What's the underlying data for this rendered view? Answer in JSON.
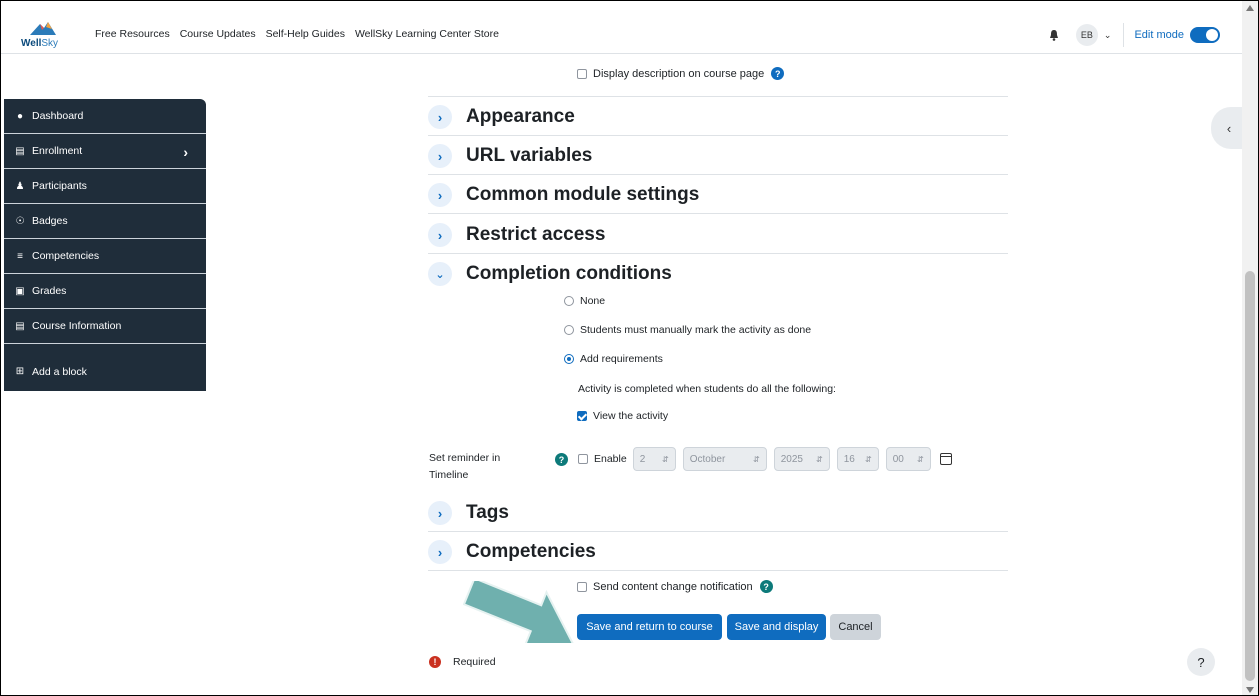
{
  "brand": {
    "name_a": "Well",
    "name_b": "Sky"
  },
  "nav": {
    "items": [
      "Free Resources",
      "Course Updates",
      "Self-Help Guides",
      "WellSky Learning Center Store"
    ]
  },
  "user": {
    "initials": "EB",
    "edit_mode_label": "Edit mode",
    "edit_mode_on": true
  },
  "sidebar": {
    "items": [
      {
        "label": "Dashboard",
        "icon": "dashboard-icon"
      },
      {
        "label": "Enrollment",
        "icon": "bank-icon",
        "has_submenu": true
      },
      {
        "label": "Participants",
        "icon": "users-icon"
      },
      {
        "label": "Badges",
        "icon": "badge-icon"
      },
      {
        "label": "Competencies",
        "icon": "list-icon"
      },
      {
        "label": "Grades",
        "icon": "grades-icon"
      },
      {
        "label": "Course Information",
        "icon": "info-card-icon"
      },
      {
        "label": "Add a block",
        "icon": "plus-square-icon"
      }
    ]
  },
  "form": {
    "display_description": "Display description on course page",
    "sections": {
      "appearance": "Appearance",
      "url_variables": "URL variables",
      "common_module": "Common module settings",
      "restrict_access": "Restrict access",
      "completion": "Completion conditions",
      "tags": "Tags",
      "competencies": "Competencies"
    },
    "completion": {
      "none": "None",
      "manual": "Students must manually mark the activity as done",
      "add_requirements": "Add requirements",
      "selected": "add_requirements",
      "info": "Activity is completed when students do all the following:",
      "view_activity": "View the activity",
      "view_activity_checked": true
    },
    "reminder": {
      "label": "Set reminder in Timeline",
      "enable": "Enable",
      "day": "2",
      "month": "October",
      "year": "2025",
      "hour": "16",
      "minute": "00"
    },
    "send_notification": "Send content change notification",
    "buttons": {
      "save_return": "Save and return to course",
      "save_display": "Save and display",
      "cancel": "Cancel"
    },
    "required": "Required"
  },
  "help_fab": "?",
  "colors": {
    "primary": "#0f6cbf",
    "sidebar_bg": "#1f2d3a",
    "arrow": "#6fb0ae"
  }
}
